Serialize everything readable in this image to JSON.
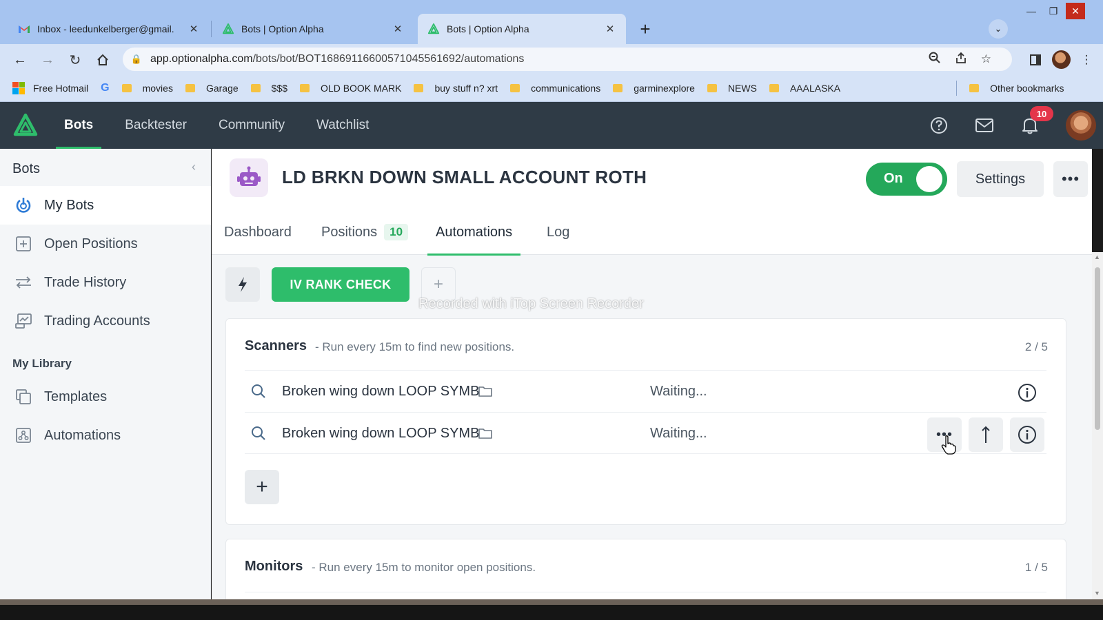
{
  "browser": {
    "tabs": [
      {
        "title": "Inbox - leedunkelberger@gmail.",
        "active": false,
        "favicon": "gmail-icon"
      },
      {
        "title": "Bots | Option Alpha",
        "active": false,
        "favicon": "option-alpha-icon"
      },
      {
        "title": "Bots | Option Alpha",
        "active": true,
        "favicon": "option-alpha-icon"
      }
    ],
    "url_host": "app.optionalpha.com",
    "url_path": "/bots/bot/BOT1686911660057104556169​2/automations",
    "bookmarks": [
      "Free Hotmail",
      "movies",
      "Garage",
      "$$$",
      "OLD BOOK MARK",
      "buy stuff n? xrt",
      "communications",
      "garminexplore",
      "NEWS",
      "AAALASKA"
    ],
    "other_bookmarks": "Other bookmarks"
  },
  "header": {
    "nav": [
      "Bots",
      "Backtester",
      "Community",
      "Watchlist"
    ],
    "active_nav": "Bots",
    "notification_count": "10",
    "accent": "#2ebd6b",
    "bg": "#2f3b46"
  },
  "sidebar": {
    "title": "Bots",
    "items": [
      {
        "label": "My Bots",
        "icon": "power-icon",
        "active": true
      },
      {
        "label": "Open Positions",
        "icon": "plus-box-icon",
        "active": false
      },
      {
        "label": "Trade History",
        "icon": "transfer-arrows-icon",
        "active": false
      },
      {
        "label": "Trading Accounts",
        "icon": "chart-card-icon",
        "active": false
      }
    ],
    "library_title": "My Library",
    "library_items": [
      {
        "label": "Templates",
        "icon": "templates-icon"
      },
      {
        "label": "Automations",
        "icon": "automations-icon"
      }
    ]
  },
  "bot": {
    "name": "LD BRKN DOWN SMALL ACCOUNT ROTH",
    "toggle_label": "On",
    "toggle_on": true,
    "settings_label": "Settings",
    "more_label": "•••"
  },
  "tabs": {
    "items": [
      "Dashboard",
      "Positions",
      "Automations",
      "Log"
    ],
    "positions_count": "10",
    "active": "Automations"
  },
  "automation_bar": {
    "button_label": "IV RANK CHECK",
    "watermark": "Recorded with iTop Screen Recorder"
  },
  "scanners": {
    "title": "Scanners",
    "subtitle": "- Run every 15m to find new positions.",
    "count": "2 / 5",
    "rows": [
      {
        "name": "Broken wing down LOOP SYMB",
        "status": "Waiting..."
      },
      {
        "name": "Broken wing down LOOP SYMB",
        "status": "Waiting..."
      }
    ],
    "add_label": "+"
  },
  "monitors": {
    "title": "Monitors",
    "subtitle": "- Run every 15m to monitor open positions.",
    "count": "1 / 5"
  }
}
